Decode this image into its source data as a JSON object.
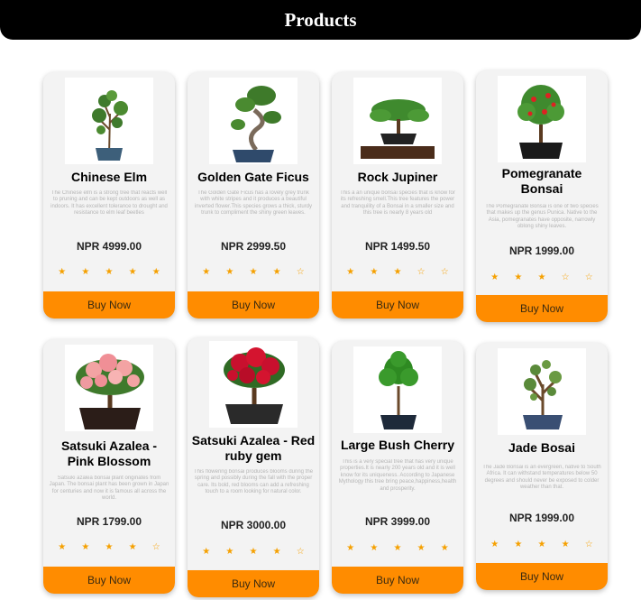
{
  "header": {
    "title": "Products"
  },
  "colors": {
    "header_bg": "#000000",
    "button": "#ff8c00",
    "star": "#f5a000",
    "card_bg": "#f3f3f3"
  },
  "products": [
    {
      "name": "Chinese Elm",
      "description": "The Chinese elm is a strong tree that reacts well to pruning and can be kept outdoors as well as indoors. It has excellent tolerance to drought and resistance to elm leaf beetles",
      "price": "NPR 4999.00",
      "stars": "★ ★ ★ ★ ★",
      "rating": 5,
      "button": "Buy Now"
    },
    {
      "name": "Golden Gate Ficus",
      "description": "The Golden Gate Ficus has a lovely grey trunk with white stripes and it produces a beautiful inverted flower.This species grows a thick, sturdy trunk to compliment the shiny green leaves.",
      "price": "NPR 2999.50",
      "stars": "★ ★ ★ ★ ☆",
      "rating": 4,
      "button": "Buy Now"
    },
    {
      "name": "Rock Jupiner",
      "description": "This a an unique bonsai species that is know for its refreshing smell.This tree features the power and tranquility of a Bonsai in a smaller size and this tree is nearly 8 years old",
      "price": "NPR 1499.50",
      "stars": "★ ★ ★ ☆ ☆",
      "rating": 3,
      "button": "Buy Now"
    },
    {
      "name": "Pomegranate Bonsai",
      "description": "The Pomegranate Bonsai is one of two species that makes up the genus Punica. Native to the Asia, pomegranates have opposite, narrowly oblong shiny leaves.",
      "price": "NPR 1999.00",
      "stars": "★ ★ ★ ☆ ☆",
      "rating": 3,
      "button": "Buy Now"
    },
    {
      "name": "Satsuki Azalea - Pink Blossom",
      "description": "Satsuki azalea bonsai plant originates from Japan. The bonsai plant has been grown in Japan for centuries and now it is famous all across the world.",
      "price": "NPR 1799.00",
      "stars": "★ ★ ★ ★ ☆",
      "rating": 4,
      "button": "Buy Now"
    },
    {
      "name": "Satsuki Azalea - Red ruby gem",
      "description": "This flowering bonsai produces blooms during the spring and possibly during the fall with the proper care. Its bold, red blooms can add a refreshing touch to a room looking for natural color.",
      "price": "NPR 3000.00",
      "stars": "★ ★ ★ ★ ☆",
      "rating": 4,
      "button": "Buy Now"
    },
    {
      "name": "Large Bush Cherry",
      "description": "This is a very special tree that has very unique properties.It is nearly 200 years old and it is well know for its uniqueness. According to Japanese Mythology this tree bring peace,happiness,health and prosperity.",
      "price": "NPR 3999.00",
      "stars": "★ ★ ★ ★ ★",
      "rating": 5,
      "button": "Buy Now"
    },
    {
      "name": "Jade Bosai",
      "description": "The Jade Bonsai is an evergreen, native to South Africa. It can withstand temperatures below 50 degrees and should never be exposed to colder weather than that.",
      "price": "NPR 1999.00",
      "stars": "★ ★ ★ ★ ☆",
      "rating": 4,
      "button": "Buy Now"
    }
  ]
}
